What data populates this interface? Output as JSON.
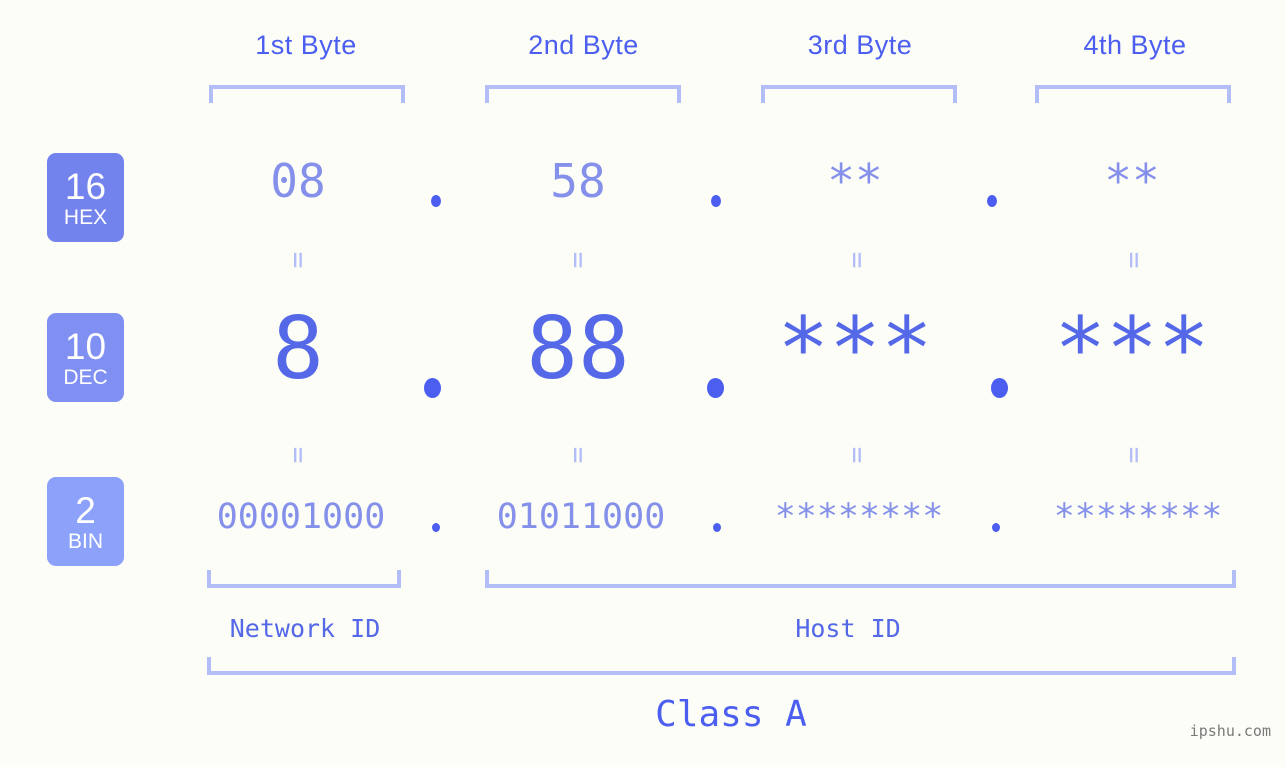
{
  "meta": {
    "background_color": "#fbfdf6",
    "accent_color": "#4b5ef0",
    "light_accent_color": "#b3bdf8",
    "watermark": "ipshu.com"
  },
  "columns": [
    {
      "header": "1st Byte",
      "hex": "08",
      "dec": "8",
      "bin": "00001000"
    },
    {
      "header": "2nd Byte",
      "hex": "58",
      "dec": "88",
      "bin": "01011000"
    },
    {
      "header": "3rd Byte",
      "hex": "**",
      "dec": "***",
      "bin": "********"
    },
    {
      "header": "4th Byte",
      "hex": "**",
      "dec": "***",
      "bin": "********"
    }
  ],
  "rows": [
    {
      "num": "16",
      "label": "HEX",
      "color": "#7383ed"
    },
    {
      "num": "10",
      "label": "DEC",
      "color": "#7f8ff2"
    },
    {
      "num": "2",
      "label": "BIN",
      "color": "#8ca2fa"
    }
  ],
  "separators": {
    "dot": ".",
    "equals": "="
  },
  "segments": {
    "network_id": "Network ID",
    "host_id": "Host ID"
  },
  "class_label": "Class A",
  "chart_data": {
    "type": "table",
    "title": "IPv4 address byte breakdown",
    "columns": [
      "1st Byte",
      "2nd Byte",
      "3rd Byte",
      "4th Byte"
    ],
    "rows": [
      {
        "base": 16,
        "base_label": "HEX",
        "values": [
          "08",
          "58",
          "**",
          "**"
        ]
      },
      {
        "base": 10,
        "base_label": "DEC",
        "values": [
          "8",
          "88",
          "***",
          "***"
        ]
      },
      {
        "base": 2,
        "base_label": "BIN",
        "values": [
          "00001000",
          "01011000",
          "********",
          "********"
        ]
      }
    ],
    "network_id_bytes": 1,
    "host_id_bytes": 3,
    "ip_class": "Class A"
  }
}
